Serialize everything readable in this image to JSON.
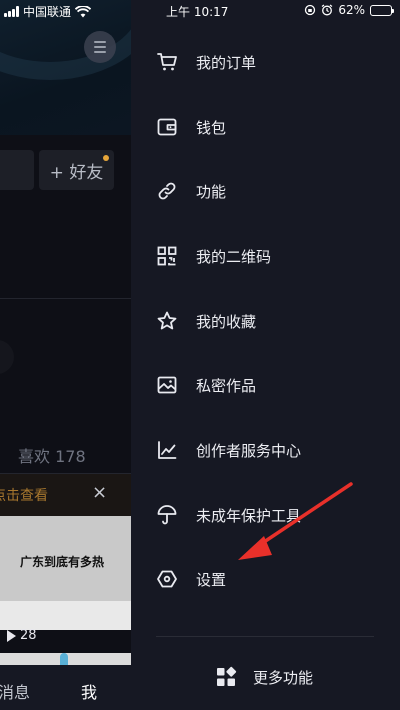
{
  "status_bar": {
    "carrier": "中国联通",
    "time": "上午 10:17",
    "battery": "62%",
    "battery_level": 0.62
  },
  "background": {
    "add_friend_label": "+ 好友",
    "likes_label": "喜欢 178",
    "notice_text": "点击查看",
    "close_glyph": "×",
    "video_title": "广东到底有多热",
    "play_count": "28",
    "tab_messages": "消息",
    "tab_me": "我"
  },
  "drawer": {
    "items": [
      {
        "label": "我的订单",
        "icon": "cart-icon"
      },
      {
        "label": "钱包",
        "icon": "wallet-icon"
      },
      {
        "label": "功能",
        "icon": "link-icon"
      },
      {
        "label": "我的二维码",
        "icon": "qrcode-icon"
      },
      {
        "label": "我的收藏",
        "icon": "star-icon"
      },
      {
        "label": "私密作品",
        "icon": "private-image-icon"
      },
      {
        "label": "创作者服务中心",
        "icon": "chart-icon"
      },
      {
        "label": "未成年保护工具",
        "icon": "umbrella-icon"
      },
      {
        "label": "设置",
        "icon": "settings-hexagon-icon"
      }
    ],
    "more_label": "更多功能",
    "more_icon": "grid-icon"
  },
  "colors": {
    "drawer_bg": "#161823",
    "annotation_arrow": "#e8302a",
    "notice_text": "#a7772e"
  }
}
